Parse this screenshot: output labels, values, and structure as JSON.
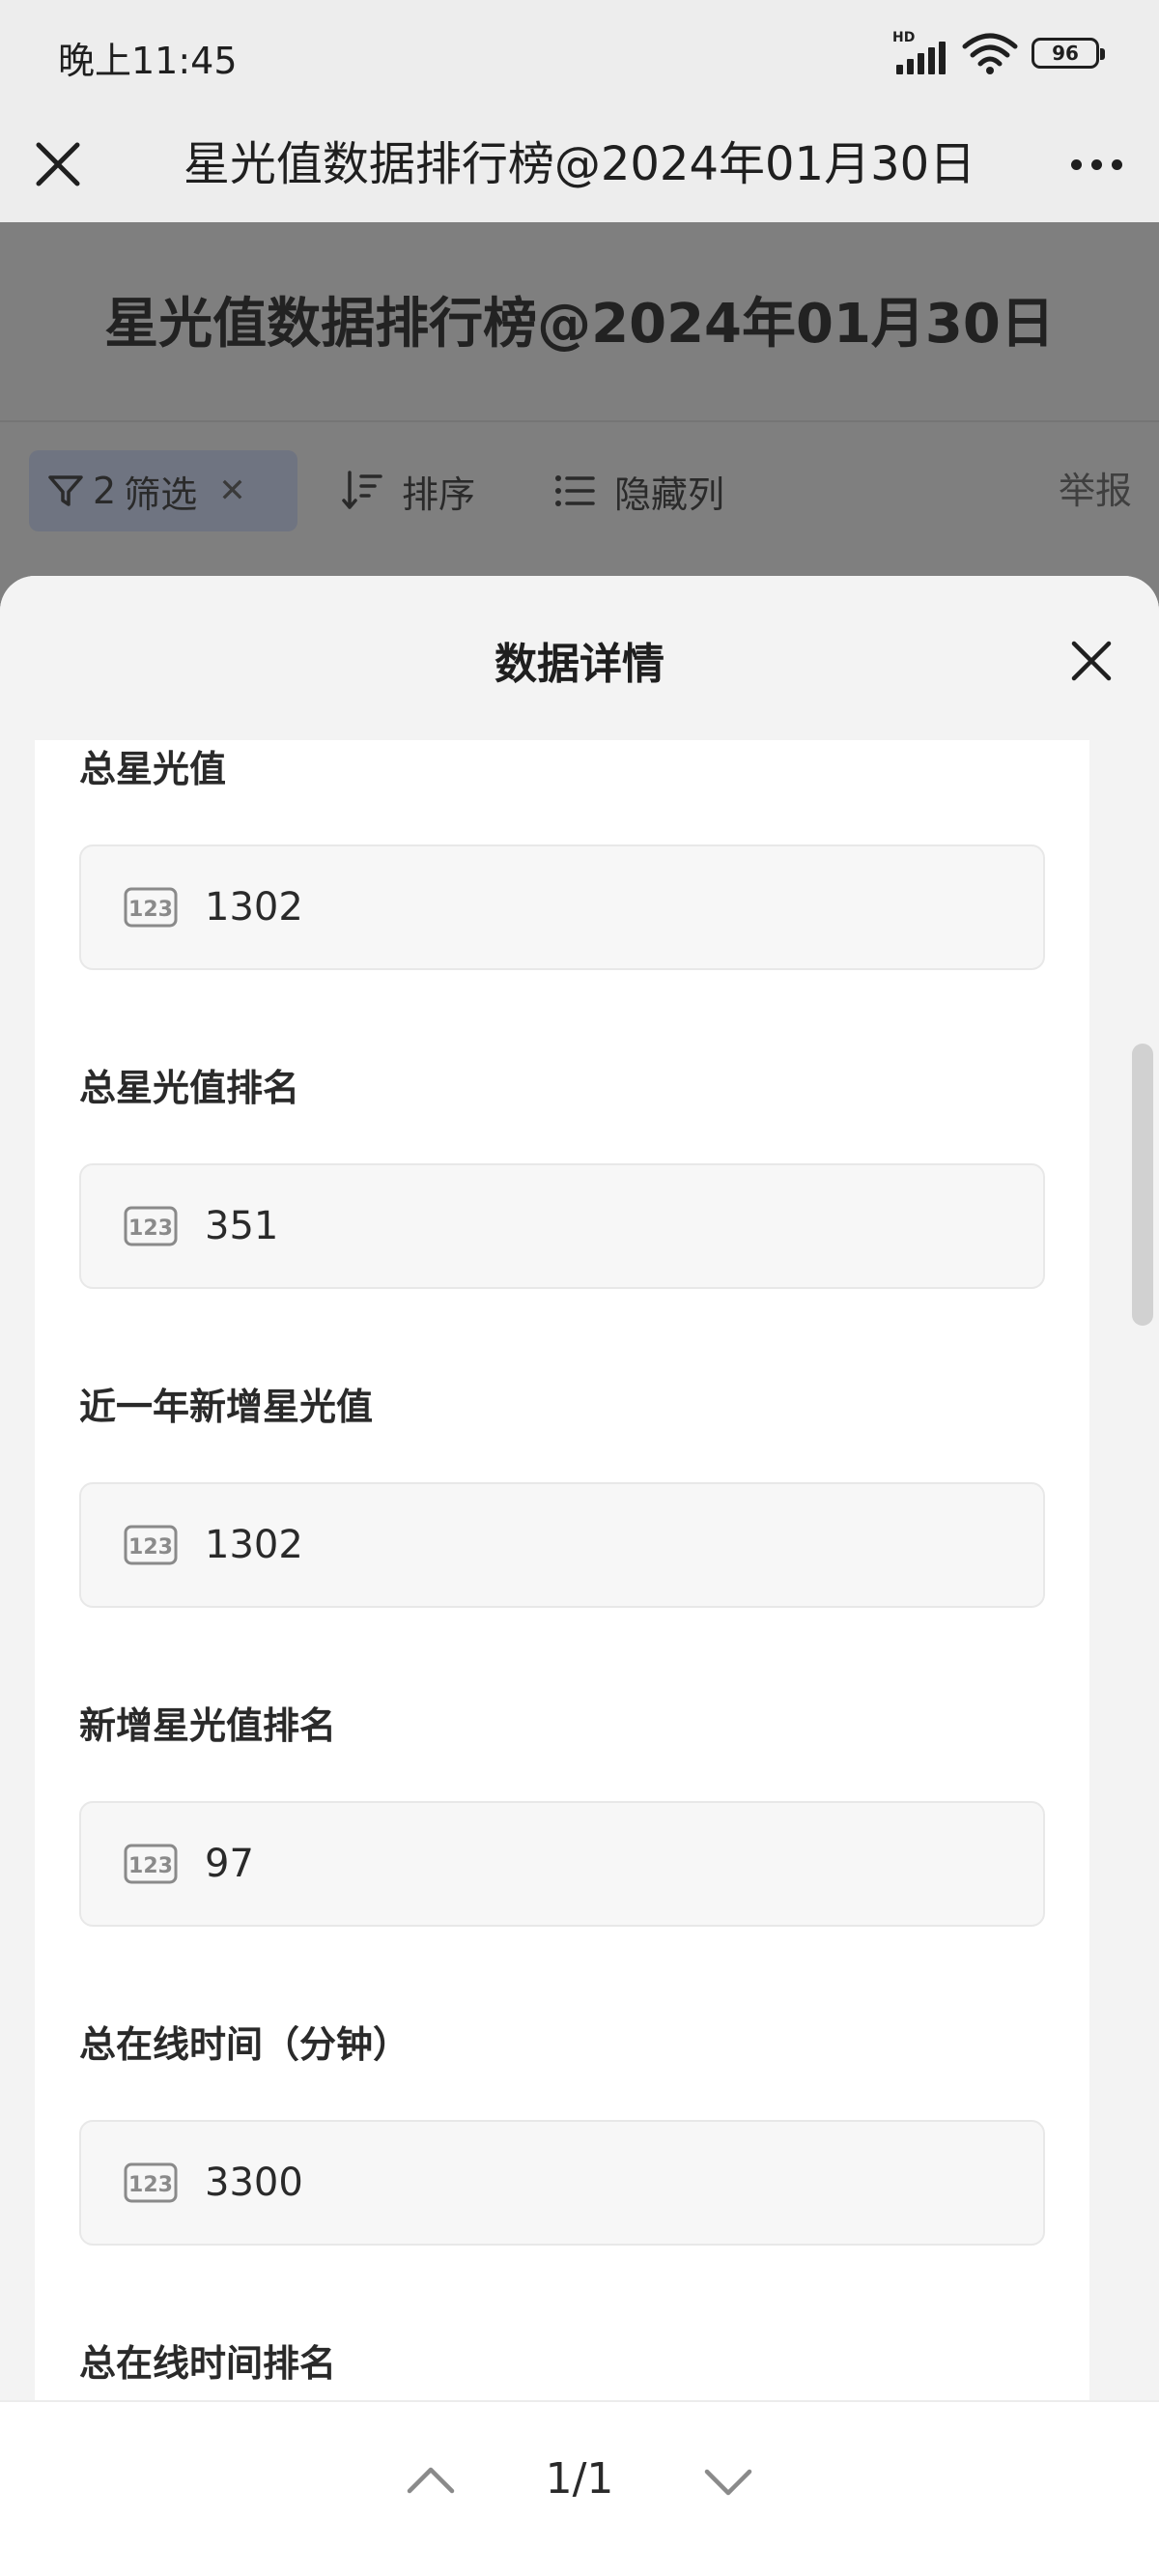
{
  "status_bar": {
    "time": "晚上11:45",
    "signal_label": "HD",
    "battery": "96"
  },
  "nav": {
    "title": "星光值数据排行榜@2024年01月30日"
  },
  "page": {
    "title": "星光值数据排行榜@2024年01月30日",
    "toolbar": {
      "filter_count": "2",
      "filter_label": "筛选",
      "sort_label": "排序",
      "hide_columns_label": "隐藏列",
      "report_label": "举报"
    }
  },
  "sheet": {
    "title": "数据详情",
    "fields": [
      {
        "label": "总星光值",
        "value": "1302"
      },
      {
        "label": "总星光值排名",
        "value": "351"
      },
      {
        "label": "近一年新增星光值",
        "value": "1302"
      },
      {
        "label": "新增星光值排名",
        "value": "97"
      },
      {
        "label": "总在线时间（分钟）",
        "value": "3300"
      },
      {
        "label": "总在线时间排名",
        "value": ""
      }
    ],
    "pager": {
      "count": "1/1"
    }
  },
  "colors": {
    "sheet_bg": "#f3f3f3",
    "dim_overlay": "#7f7f7f",
    "field_bg": "#f7f7f7"
  }
}
